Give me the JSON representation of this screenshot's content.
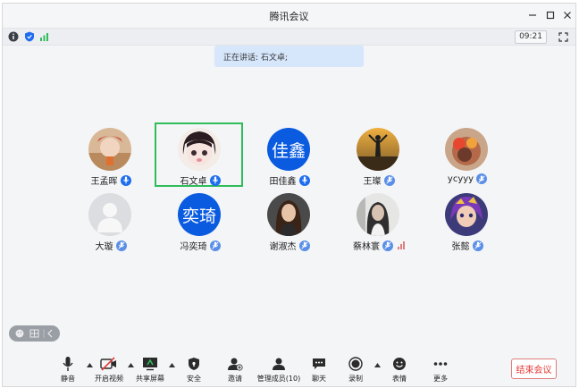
{
  "window": {
    "title": "腾讯会议"
  },
  "statusbar": {
    "time": "09:21"
  },
  "speaking": {
    "text": "正在讲话: 石文卓;"
  },
  "participants": [
    {
      "name": "王孟晖",
      "avatar": "photo",
      "mic": "on"
    },
    {
      "name": "石文卓",
      "avatar": "photo",
      "mic": "on",
      "active_speaker": true
    },
    {
      "name": "田佳鑫",
      "avatar": "text",
      "avatar_text": "佳鑫",
      "mic": "on"
    },
    {
      "name": "王璨",
      "avatar": "photo",
      "mic": "off"
    },
    {
      "name": "ycyyy",
      "avatar": "photo",
      "mic": "off"
    },
    {
      "name": "大璇",
      "avatar": "default",
      "mic": "off"
    },
    {
      "name": "冯奕琦",
      "avatar": "text",
      "avatar_text": "奕琦",
      "mic": "off"
    },
    {
      "name": "谢淑杰",
      "avatar": "photo",
      "mic": "off"
    },
    {
      "name": "蔡林寰",
      "avatar": "photo",
      "mic": "off"
    },
    {
      "name": "张懿",
      "avatar": "photo",
      "mic": "off"
    }
  ],
  "toolbar": {
    "mute": "静音",
    "video": "开启视频",
    "share": "共享屏幕",
    "security": "安全",
    "invite": "邀请",
    "members": "管理成员(10)",
    "chat": "聊天",
    "record": "录制",
    "reactions": "表情",
    "more": "更多",
    "end": "结束会议"
  },
  "colors": {
    "accent": "#1d6df0",
    "active_speaker_border": "#2fbd5b",
    "end_meeting": "#e53935",
    "speaking_banner": "#d6e6fb"
  }
}
